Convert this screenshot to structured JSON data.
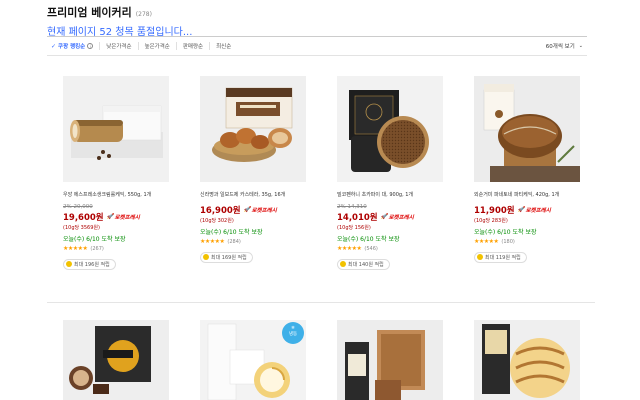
{
  "header": {
    "title": "프리미엄 베이커리",
    "count": "(278)",
    "notice": "현재 페이지 52 청목 품절입니다..."
  },
  "sort": {
    "options": [
      "쿠팡 랭킹순",
      "낮은가격순",
      "높은가격순",
      "판매량순",
      "최신순"
    ],
    "per_page": "60개씩 보기"
  },
  "products_row1": [
    {
      "name": "우앙 에스프레소생크림롤케익, 550g, 1개",
      "old_price": "2% 20,000",
      "price": "19,600원",
      "rocket": "로켓프레시",
      "unit": "(10g당 3569원)",
      "delivery": "오늘(수) 6/10 도착 보장",
      "stars": "★★★★★",
      "reviews": "(267)",
      "reward": "최대 196원 적립"
    },
    {
      "name": "신라명과 일보드제 카스테라, 35g, 16개",
      "old_price": "",
      "price": "16,900원",
      "rocket": "로켓프레시",
      "unit": "(10g당 302원)",
      "delivery": "오늘(수) 6/10 도착 보장",
      "stars": "★★★★★",
      "reviews": "(284)",
      "reward": "최대 169원 적립"
    },
    {
      "name": "빌코펜하니 초카파이 대, 900g, 1개",
      "old_price": "2% 14,310",
      "price": "14,010원",
      "rocket": "로켓프레시",
      "unit": "(10g당 156원)",
      "delivery": "오늘(수) 6/10 도착 보장",
      "stars": "★★★★★",
      "reviews": "(546)",
      "reward": "최대 140원 적립"
    },
    {
      "name": "외순거미 파네토네 파티케익, 420g, 1개",
      "old_price": "",
      "price": "11,900원",
      "rocket": "로켓프레시",
      "unit": "(10g당 283원)",
      "delivery": "오늘(수) 6/10 도착 보장",
      "stars": "★★★★★",
      "reviews": "(180)",
      "reward": "최대 119원 적립"
    }
  ],
  "frozen_badge": "냉동",
  "colors": {
    "accent": "#346aff",
    "price": "#ae0000",
    "delivery": "#008c00",
    "star": "#ffa000"
  }
}
